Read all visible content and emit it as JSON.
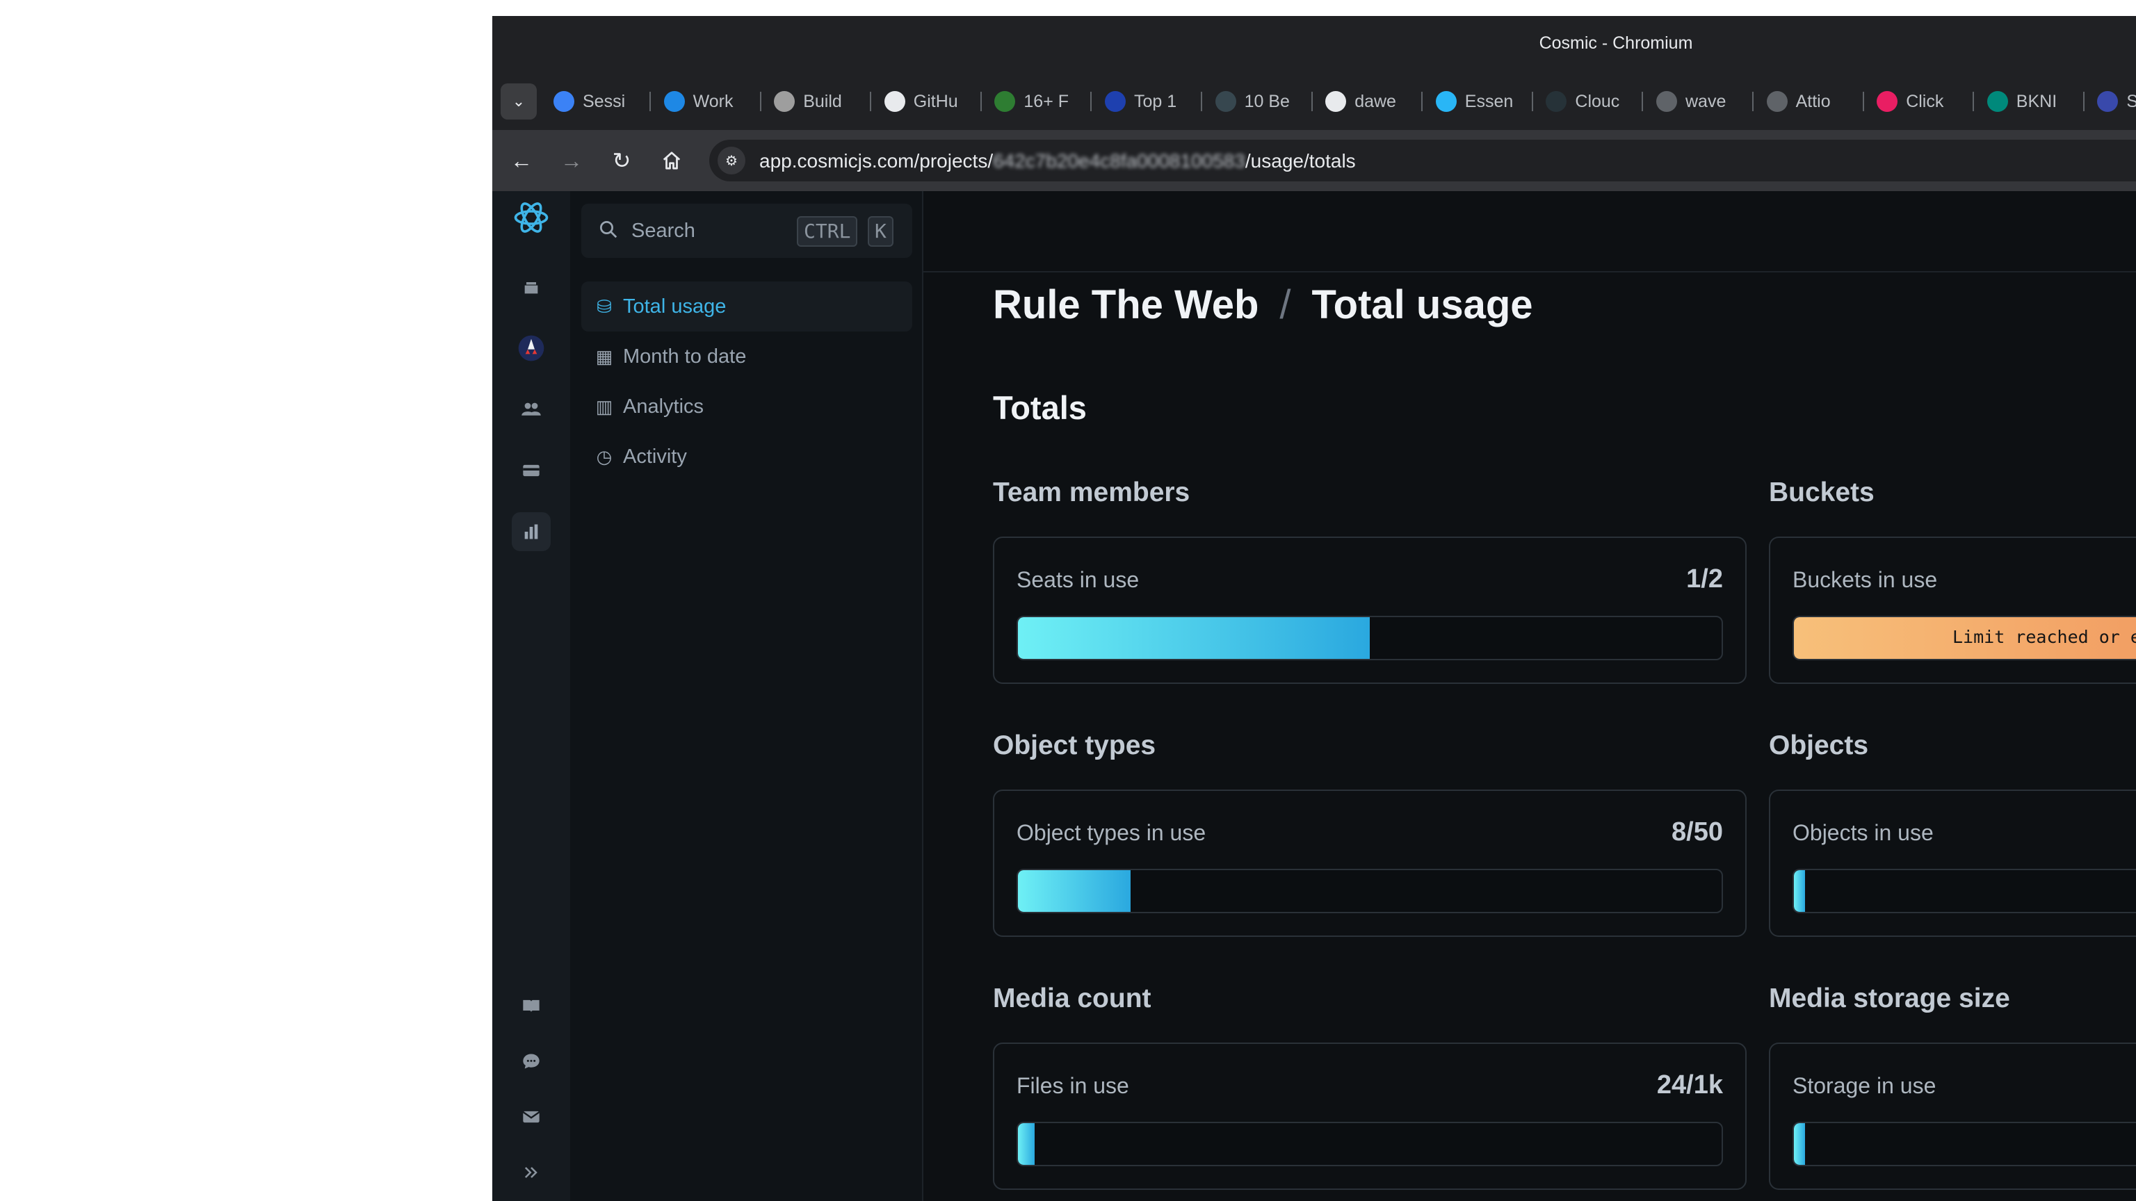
{
  "window": {
    "title": "Cosmic - Chromium"
  },
  "tabs": [
    {
      "label": "Sessi",
      "favicon_color": "#3b82f6"
    },
    {
      "label": "Work",
      "favicon_color": "#1e88e5"
    },
    {
      "label": "Build",
      "favicon_color": "#9e9e9e"
    },
    {
      "label": "GitHu",
      "favicon_color": "#e8eaed"
    },
    {
      "label": "16+ F",
      "favicon_color": "#2e7d32"
    },
    {
      "label": "Top 1",
      "favicon_color": "#1e40af"
    },
    {
      "label": "10 Be",
      "favicon_color": "#37474f"
    },
    {
      "label": "dawe",
      "favicon_color": "#e8eaed"
    },
    {
      "label": "Essen",
      "favicon_color": "#29b6f6"
    },
    {
      "label": "Clouc",
      "favicon_color": "#263238"
    },
    {
      "label": "wave",
      "favicon_color": "#5f6368"
    },
    {
      "label": "Attio",
      "favicon_color": "#5f6368"
    },
    {
      "label": "Click",
      "favicon_color": "#e91e63"
    },
    {
      "label": "BKNI",
      "favicon_color": "#00897b"
    },
    {
      "label": "Sl",
      "favicon_color": "#3949ab"
    }
  ],
  "address": {
    "url_prefix": "app.cosmicjs.com/projects/",
    "url_redacted": "642c7b20e4c8fa0008100583",
    "url_suffix": "/usage/totals"
  },
  "search": {
    "label": "Search",
    "kbd1": "CTRL",
    "kbd2": "K"
  },
  "subnav": [
    {
      "label": "Total usage",
      "icon": "database-icon",
      "active": true
    },
    {
      "label": "Month to date",
      "icon": "calendar-icon",
      "active": false
    },
    {
      "label": "Analytics",
      "icon": "chart-icon",
      "active": false
    },
    {
      "label": "Activity",
      "icon": "clock-icon",
      "active": false
    }
  ],
  "page": {
    "project": "Rule The Web",
    "separator": "/",
    "title": "Total usage",
    "section": "Totals"
  },
  "groups": {
    "team": {
      "title": "Team members",
      "label": "Seats in use",
      "value": "1/2",
      "fraction": 0.5
    },
    "buckets": {
      "title": "Buckets",
      "label": "Buckets in use",
      "warning": "Limit reached or exc",
      "fraction": 1.0
    },
    "object_types": {
      "title": "Object types",
      "label": "Object types in use",
      "value": "8/50",
      "fraction": 0.16
    },
    "objects": {
      "title": "Objects",
      "label": "Objects in use",
      "fraction": 0.02
    },
    "media_count": {
      "title": "Media count",
      "label": "Files in use",
      "value": "24/1k",
      "fraction": 0.024
    },
    "media_storage": {
      "title": "Media storage size",
      "label": "Storage in use",
      "fraction": 0.02
    }
  },
  "colors": {
    "accent": "#3fb5e8",
    "bar_start": "#6ff0f5",
    "bar_end": "#2aa8df",
    "warn_start": "#f7c07a",
    "warn_end": "#f0915a"
  }
}
